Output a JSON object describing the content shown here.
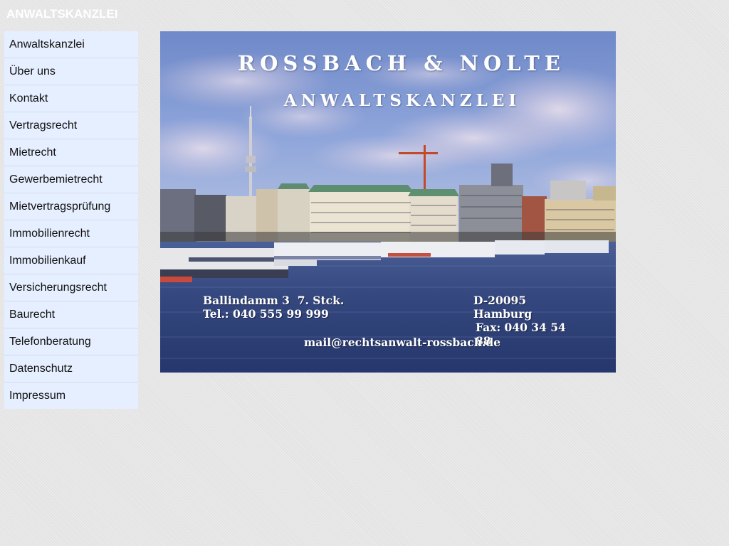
{
  "header": {
    "site_title": "ANWALTSKANZLEI"
  },
  "nav": {
    "items": [
      "Anwaltskanzlei",
      "Über uns",
      "Kontakt",
      "Vertragsrecht",
      "Mietrecht",
      "Gewerbemietrecht",
      "Mietvertragsprüfung",
      "Immobilienrecht",
      "Immobilienkauf",
      "Versicherungsrecht",
      "Baurecht",
      "Telefonberatung",
      "Datenschutz",
      "Impressum"
    ]
  },
  "hero": {
    "firm_name": "ROSSBACH & NOLTE",
    "firm_subtitle": "ANWALTSKANZLEI",
    "street": "Ballindamm 3  7. Stck.",
    "phone": "Tel.: 040 555 99 999",
    "city": "D-20095 Hamburg",
    "fax": "Fax: 040 34 54 88",
    "email": "mail@rechtsanwalt-rossbach.de"
  },
  "colors": {
    "nav_background": "#e6efff",
    "page_background": "#e3e3e3",
    "sky": "#7e97cf",
    "water": "#35487f"
  }
}
